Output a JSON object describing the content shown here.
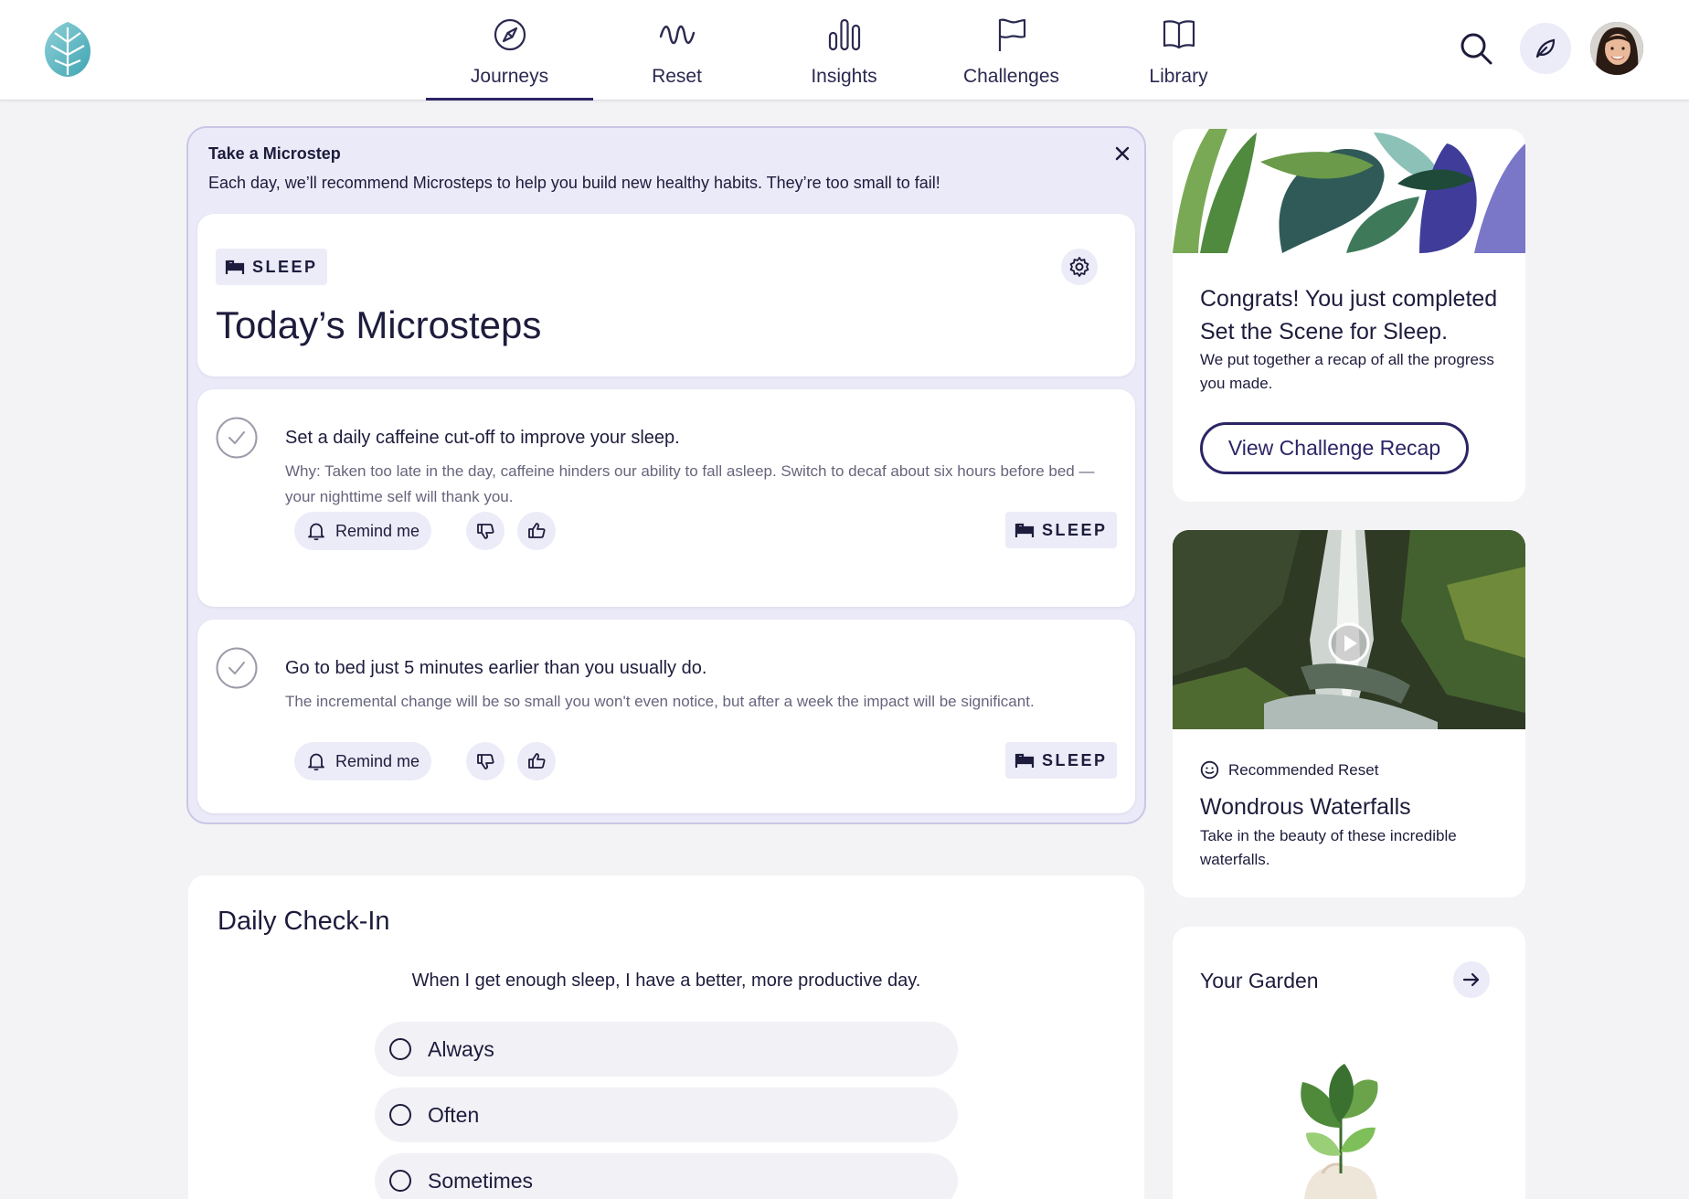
{
  "nav": {
    "items": [
      {
        "label": "Journeys",
        "icon": "compass-icon",
        "active": true
      },
      {
        "label": "Reset",
        "icon": "wave-icon"
      },
      {
        "label": "Insights",
        "icon": "bar-chart-icon"
      },
      {
        "label": "Challenges",
        "icon": "flag-icon"
      },
      {
        "label": "Library",
        "icon": "book-icon"
      }
    ]
  },
  "microstep": {
    "banner_title": "Take a Microstep",
    "banner_sub": "Each day, we’ll recommend Microsteps to help you build new healthy habits. They’re too small to fail!",
    "tag": "SLEEP",
    "heading": "Today’s Microsteps",
    "steps": [
      {
        "title": "Set a daily caffeine cut-off to improve your sleep.",
        "why": "Why: Taken too late in the day, caffeine hinders our ability to fall asleep. Switch to decaf about six hours before bed — your nighttime self will thank you.",
        "remind": "Remind me",
        "tag": "SLEEP"
      },
      {
        "title": "Go to bed just 5 minutes earlier than you usually do.",
        "why": "The incremental change will be so small you won't even notice, but after a week the impact will be significant.",
        "remind": "Remind me",
        "tag": "SLEEP"
      }
    ]
  },
  "checkin": {
    "title": "Daily Check-In",
    "question": "When I get enough sleep, I have a better, more productive day.",
    "options": [
      "Always",
      "Often",
      "Sometimes"
    ]
  },
  "congrats": {
    "title": "Congrats! You just completed Set the Scene for Sleep.",
    "sub": "We put together a recap of all the progress you made.",
    "button": "View Challenge Recap"
  },
  "reset": {
    "kicker": "Recommended Reset",
    "title": "Wondrous Waterfalls",
    "sub": "Take in the beauty of these incredible waterfalls."
  },
  "garden": {
    "title": "Your Garden"
  },
  "colors": {
    "primary": "#2b2566",
    "accent_bg": "#ecebf8",
    "page_bg": "#f3f3f5",
    "text": "#1d1c3c"
  }
}
